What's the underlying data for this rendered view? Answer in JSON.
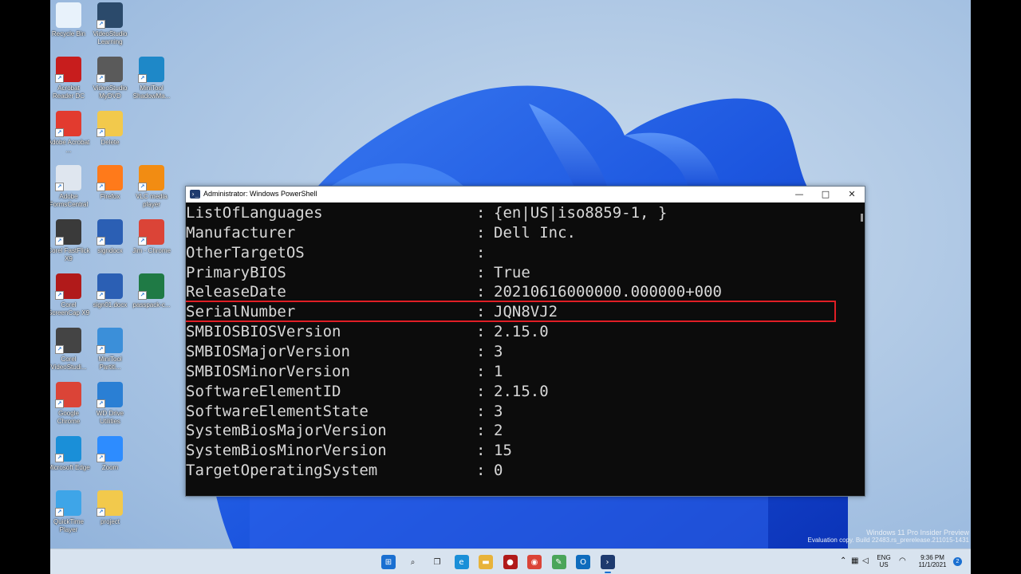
{
  "desktop_icons": [
    {
      "label": "Recycle Bin",
      "icon": "recycle-bin-icon",
      "color": "#e8f2fb"
    },
    {
      "label": "VideoStudio Learning",
      "icon": "videostudio-learning-icon",
      "color": "#2b4a6b"
    },
    {
      "label": "Acrobat Reader DC",
      "icon": "acrobat-reader-icon",
      "color": "#c81d1d"
    },
    {
      "label": "VideoStudio MyDVD",
      "icon": "videostudio-mydvd-icon",
      "color": "#5a5a5a"
    },
    {
      "label": "MiniTool ShadowMa...",
      "icon": "minitool-shadowmaker-icon",
      "color": "#1e88c8"
    },
    {
      "label": "Adobe Acrobat ...",
      "icon": "adobe-acrobat-icon",
      "color": "#e23b2f"
    },
    {
      "label": "Delete",
      "icon": "folder-icon",
      "color": "#f2c94c"
    },
    {
      "label": "Adobe FormsCentral",
      "icon": "formscentral-icon",
      "color": "#dfe6ef"
    },
    {
      "label": "Firefox",
      "icon": "firefox-icon",
      "color": "#ff7a1a"
    },
    {
      "label": "VLC media player",
      "icon": "vlc-icon",
      "color": "#f28c12"
    },
    {
      "label": "Corel FastFlick X9",
      "icon": "corel-fastflick-icon",
      "color": "#3a3a3a"
    },
    {
      "label": "signdocx",
      "icon": "word-doc-icon",
      "color": "#2b5fb4"
    },
    {
      "label": "Jim - Chrome",
      "icon": "chrome-profile-icon",
      "color": "#db4437"
    },
    {
      "label": "Corel ScreenCap X9",
      "icon": "corel-screencap-icon",
      "color": "#b11a1a"
    },
    {
      "label": "sign01.docx",
      "icon": "word-doc-icon",
      "color": "#2b5fb4"
    },
    {
      "label": "passpack-c...",
      "icon": "excel-doc-icon",
      "color": "#1f7a45"
    },
    {
      "label": "Corel VideoStudi...",
      "icon": "corel-videostudio-icon",
      "color": "#444444"
    },
    {
      "label": "MiniTool Partiti...",
      "icon": "minitool-partition-icon",
      "color": "#3b8fd9"
    },
    {
      "label": "Google Chrome",
      "icon": "chrome-icon",
      "color": "#db4437"
    },
    {
      "label": "WD Drive Utilities",
      "icon": "wd-drive-icon",
      "color": "#2a7fd4"
    },
    {
      "label": "Microsoft Edge",
      "icon": "edge-icon",
      "color": "#1a8fd8"
    },
    {
      "label": "Zoom",
      "icon": "zoom-icon",
      "color": "#2d8cff"
    },
    {
      "label": "QuickTime Player",
      "icon": "quicktime-icon",
      "color": "#3ea5e8"
    },
    {
      "label": "project",
      "icon": "folder-icon",
      "color": "#f2c94c"
    }
  ],
  "powershell": {
    "title": "Administrator: Windows PowerShell",
    "minimize": "—",
    "maximize": "□",
    "close": "✕",
    "rows": [
      {
        "key": "ListOfLanguages",
        "value": "{en|US|iso8859-1, }"
      },
      {
        "key": "Manufacturer",
        "value": "Dell Inc."
      },
      {
        "key": "OtherTargetOS",
        "value": ""
      },
      {
        "key": "PrimaryBIOS",
        "value": "True"
      },
      {
        "key": "ReleaseDate",
        "value": "20210616000000.000000+000"
      },
      {
        "key": "SerialNumber",
        "value": "JQN8VJ2"
      },
      {
        "key": "SMBIOSBIOSVersion",
        "value": "2.15.0"
      },
      {
        "key": "SMBIOSMajorVersion",
        "value": "3"
      },
      {
        "key": "SMBIOSMinorVersion",
        "value": "1"
      },
      {
        "key": "SoftwareElementID",
        "value": "2.15.0"
      },
      {
        "key": "SoftwareElementState",
        "value": "3"
      },
      {
        "key": "SystemBiosMajorVersion",
        "value": "2"
      },
      {
        "key": "SystemBiosMinorVersion",
        "value": "15"
      },
      {
        "key": "TargetOperatingSystem",
        "value": "0"
      }
    ],
    "separator": ":",
    "highlight_color": "#e01e25"
  },
  "watermark": {
    "line1": "Windows 11 Pro Insider Preview",
    "line2": "Evaluation copy. Build 22483.rs_prerelease.211015-1431"
  },
  "taskbar": {
    "apps": [
      {
        "name": "start-button",
        "icon": "windows-start-icon",
        "glyph": "⊞"
      },
      {
        "name": "search-button",
        "icon": "search-icon",
        "glyph": "⌕"
      },
      {
        "name": "task-view-button",
        "icon": "task-view-icon",
        "glyph": "❐"
      },
      {
        "name": "edge-taskbar-button",
        "icon": "edge-icon",
        "glyph": "e"
      },
      {
        "name": "file-explorer-taskbar-button",
        "icon": "folder-icon",
        "glyph": "▬"
      },
      {
        "name": "screencap-taskbar-button",
        "icon": "corel-screencap-icon",
        "glyph": "●"
      },
      {
        "name": "chrome-taskbar-button",
        "icon": "chrome-icon",
        "glyph": "◉"
      },
      {
        "name": "notepad-taskbar-button",
        "icon": "notepad-icon",
        "glyph": "✎"
      },
      {
        "name": "outlook-taskbar-button",
        "icon": "outlook-icon",
        "glyph": "O"
      },
      {
        "name": "powershell-taskbar-button",
        "icon": "powershell-icon",
        "glyph": "›"
      }
    ],
    "tray": {
      "lang1": "ENG",
      "lang2": "US",
      "time": "9:36 PM",
      "date": "11/1/2021",
      "notification_count": "2"
    }
  }
}
